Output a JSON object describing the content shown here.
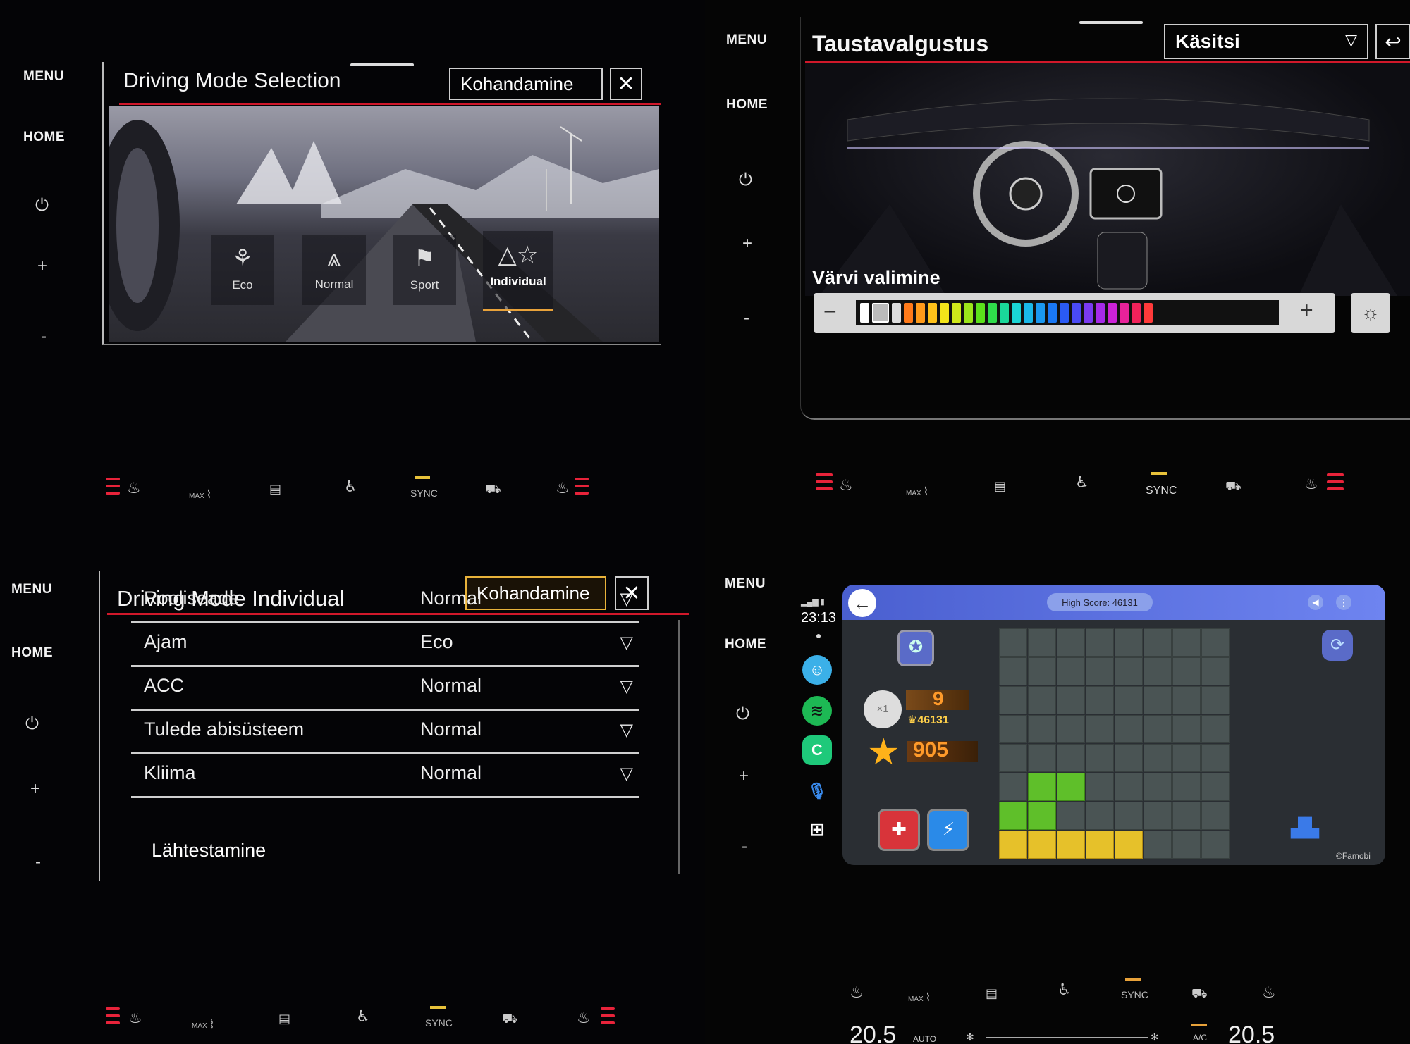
{
  "side_buttons": {
    "menu": "MENU",
    "home": "HOME",
    "power_icon": "⏻",
    "plus": "+",
    "minus": "-"
  },
  "climate": {
    "max_label": "MAX",
    "sync_label": "SYNC",
    "auto_label": "AUTO",
    "ac_label": "A/C",
    "temp_left": "20.5",
    "temp_right": "20.5"
  },
  "q1": {
    "title": "Driving Mode Selection",
    "customize_button": "Kohandamine",
    "close_icon": "✕",
    "modes": [
      {
        "label": "Eco",
        "icon": "eco-icon"
      },
      {
        "label": "Normal",
        "icon": "normal-road-icon"
      },
      {
        "label": "Sport",
        "icon": "sport-flag-icon"
      },
      {
        "label": "Individual",
        "icon": "individual-star-icon"
      }
    ],
    "selected_mode": "Individual"
  },
  "q2": {
    "title": "Taustavalgustus",
    "mode_select": "Käsitsi",
    "color_label": "Värvi valimine",
    "minus": "−",
    "plus": "+",
    "colors": [
      "#ff7a1a",
      "#ff9a1a",
      "#ffc21a",
      "#f3e51a",
      "#cfe81a",
      "#9be51a",
      "#5be01a",
      "#2fdc4a",
      "#1ad89a",
      "#1ad4d4",
      "#1ab8e8",
      "#1a98f0",
      "#1a78f4",
      "#2a5af4",
      "#4a4af4",
      "#7a3af0",
      "#a62ae8",
      "#cc22d8",
      "#e8229a",
      "#f0225a",
      "#ff3a3a"
    ]
  },
  "q3": {
    "title": "Driving Mode Individual",
    "customize_button": "Kohandamine",
    "close_icon": "✕",
    "rows": [
      {
        "label": "Rooliseade",
        "value": "Normal"
      },
      {
        "label": "Ajam",
        "value": "Eco"
      },
      {
        "label": "ACC",
        "value": "Normal"
      },
      {
        "label": "Tulede abisüsteem",
        "value": "Normal"
      },
      {
        "label": "Kliima",
        "value": "Normal"
      }
    ],
    "reset": "Lähtestamine"
  },
  "q4": {
    "time": "23:13",
    "high_score": "High Score: 46131",
    "level": "9",
    "best": "46131",
    "score": "905",
    "multiplier": "×1",
    "credit": "©Famobi"
  }
}
